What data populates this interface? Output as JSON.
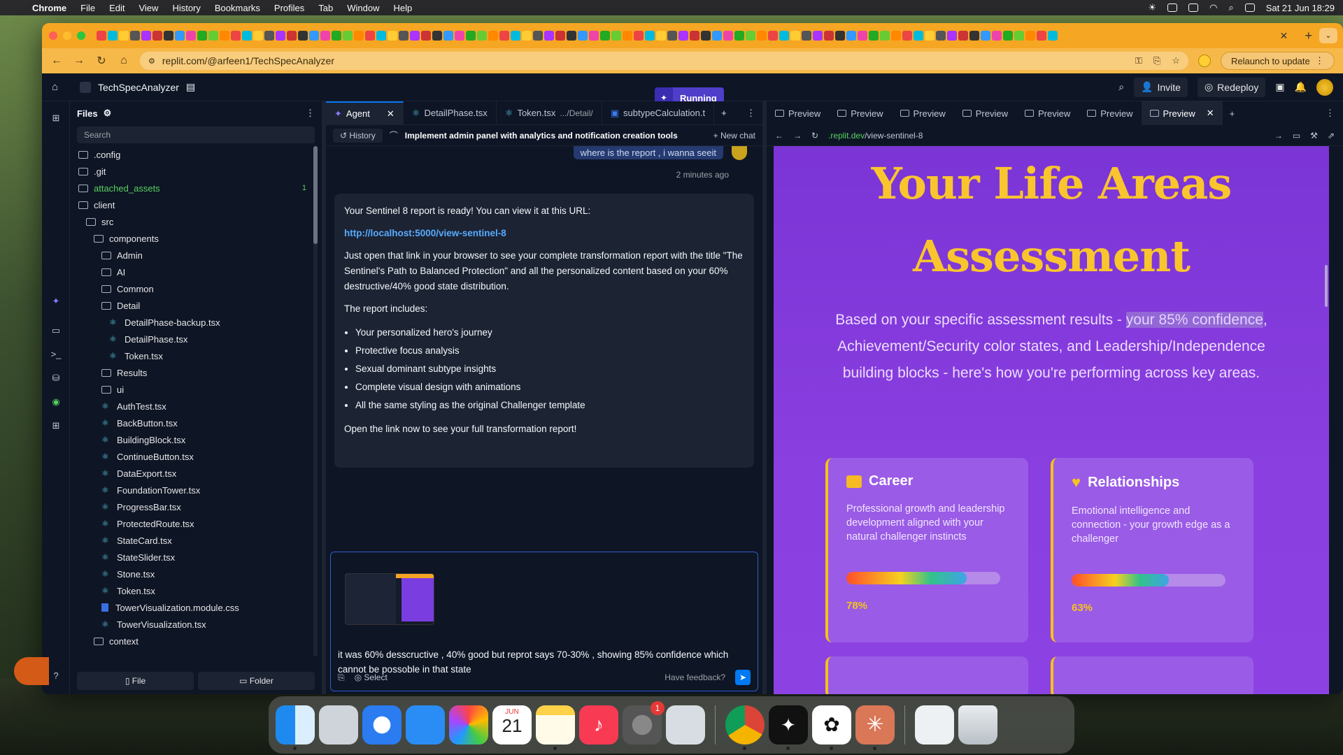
{
  "menubar": {
    "app": "Chrome",
    "items": [
      "File",
      "Edit",
      "View",
      "History",
      "Bookmarks",
      "Profiles",
      "Tab",
      "Window",
      "Help"
    ],
    "clock": "Sat 21 Jun  18:29"
  },
  "browser": {
    "url": "replit.com/@arfeen1/TechSpecAnalyzer",
    "relaunch": "Relaunch to update"
  },
  "replit": {
    "project": "TechSpecAnalyzer",
    "status": "Running",
    "invite": "Invite",
    "redeploy": "Redeploy"
  },
  "files": {
    "title": "Files",
    "search_placeholder": "Search",
    "tree": [
      {
        "name": ".config",
        "type": "folder",
        "depth": 0
      },
      {
        "name": ".git",
        "type": "folder",
        "depth": 0
      },
      {
        "name": "attached_assets",
        "type": "folder",
        "depth": 0,
        "status": "modified",
        "badge": "1"
      },
      {
        "name": "client",
        "type": "folder",
        "depth": 0
      },
      {
        "name": "src",
        "type": "folder",
        "depth": 1
      },
      {
        "name": "components",
        "type": "folder",
        "depth": 2
      },
      {
        "name": "Admin",
        "type": "folder",
        "depth": 3
      },
      {
        "name": "AI",
        "type": "folder",
        "depth": 3
      },
      {
        "name": "Common",
        "type": "folder",
        "depth": 3
      },
      {
        "name": "Detail",
        "type": "folder",
        "depth": 3
      },
      {
        "name": "DetailPhase-backup.tsx",
        "type": "react",
        "depth": 4
      },
      {
        "name": "DetailPhase.tsx",
        "type": "react",
        "depth": 4
      },
      {
        "name": "Token.tsx",
        "type": "react",
        "depth": 4
      },
      {
        "name": "Results",
        "type": "folder",
        "depth": 3
      },
      {
        "name": "ui",
        "type": "folder",
        "depth": 3
      },
      {
        "name": "AuthTest.tsx",
        "type": "react",
        "depth": 3
      },
      {
        "name": "BackButton.tsx",
        "type": "react",
        "depth": 3
      },
      {
        "name": "BuildingBlock.tsx",
        "type": "react",
        "depth": 3
      },
      {
        "name": "ContinueButton.tsx",
        "type": "react",
        "depth": 3
      },
      {
        "name": "DataExport.tsx",
        "type": "react",
        "depth": 3
      },
      {
        "name": "FoundationTower.tsx",
        "type": "react",
        "depth": 3
      },
      {
        "name": "ProgressBar.tsx",
        "type": "react",
        "depth": 3
      },
      {
        "name": "ProtectedRoute.tsx",
        "type": "react",
        "depth": 3
      },
      {
        "name": "StateCard.tsx",
        "type": "react",
        "depth": 3
      },
      {
        "name": "StateSlider.tsx",
        "type": "react",
        "depth": 3
      },
      {
        "name": "Stone.tsx",
        "type": "react",
        "depth": 3
      },
      {
        "name": "Token.tsx",
        "type": "react",
        "depth": 3
      },
      {
        "name": "TowerVisualization.module.css",
        "type": "css",
        "depth": 3
      },
      {
        "name": "TowerVisualization.tsx",
        "type": "react",
        "depth": 3
      },
      {
        "name": "context",
        "type": "folder",
        "depth": 2
      }
    ],
    "new_file": "File",
    "new_folder": "Folder"
  },
  "editor_tabs": [
    {
      "label": "Agent",
      "active": true
    },
    {
      "label": "DetailPhase.tsx",
      "active": false
    },
    {
      "label": "Token.tsx",
      "path": ".../Detail/",
      "active": false
    },
    {
      "label": "subtypeCalculation.t",
      "active": false
    }
  ],
  "agent": {
    "history": "History",
    "thread_title": "Implement admin panel with analytics and notification creation tools",
    "new_chat": "New chat",
    "user_message": "where is the report , i wanna seeit",
    "user_time": "2 minutes ago",
    "reply": {
      "p1": "Your Sentinel 8 report is ready! You can view it at this URL:",
      "link": "http://localhost:5000/view-sentinel-8",
      "p2": "Just open that link in your browser to see your complete transformation report with the title \"The Sentinel's Path to Balanced Protection\" and all the personalized content based on your 60% destructive/40% good state distribution.",
      "p3": "The report includes:",
      "bullets": [
        "Your personalized hero's journey",
        "Protective focus analysis",
        "Sexual dominant subtype insights",
        "Complete visual design with animations",
        "All the same styling as the original Challenger template"
      ],
      "p4": "Open the link now to see your full transformation report!"
    },
    "composer_text": "it was 60% desscructive , 40% good but reprot says 70-30% , showing 85% confidence which cannot be possoble in that state ",
    "select": "Select",
    "feedback": "Have feedback?"
  },
  "preview": {
    "tab_label": "Preview",
    "url_host": ".replit.dev",
    "url_path": "/view-sentinel-8",
    "hero_title": "Your Life Areas Assessment",
    "hero_text_a": "Based on your specific assessment results - ",
    "hero_text_hl": "your 85% confidence",
    "hero_text_b": ", Achievement/Security color states, and Leadership/Independence building blocks - here's how you're performing across key areas.",
    "cards": [
      {
        "title": "Career",
        "icon": "briefcase-icon",
        "text": "Professional growth and leadership development aligned with your natural challenger instincts",
        "percent_label": "78%",
        "value": 0.78
      },
      {
        "title": "Relationships",
        "icon": "heart-icon",
        "text": "Emotional intelligence and connection - your growth edge as a challenger",
        "percent_label": "63%",
        "value": 0.63
      }
    ]
  },
  "dock": {
    "calendar_month": "JUN",
    "calendar_day": "21",
    "settings_badge": "1"
  }
}
